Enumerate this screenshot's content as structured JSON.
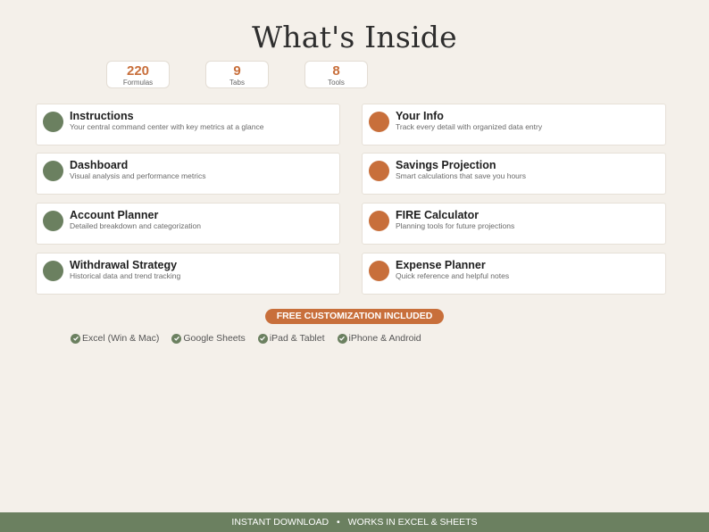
{
  "title": "What's Inside",
  "stats": [
    {
      "value": "220",
      "label": "Formulas"
    },
    {
      "value": "9",
      "label": "Tabs"
    },
    {
      "value": "8",
      "label": "Tools"
    }
  ],
  "cards": [
    {
      "title": "Instructions",
      "desc": "Your central command center with key metrics at a glance",
      "color": "#6b8060"
    },
    {
      "title": "Your Info",
      "desc": "Track every detail with organized data entry",
      "color": "#c86f3b"
    },
    {
      "title": "Dashboard",
      "desc": "Visual analysis and performance metrics",
      "color": "#6b8060"
    },
    {
      "title": "Savings Projection",
      "desc": "Smart calculations that save you hours",
      "color": "#c86f3b"
    },
    {
      "title": "Account Planner",
      "desc": "Detailed breakdown and categorization",
      "color": "#6b8060"
    },
    {
      "title": "FIRE Calculator",
      "desc": "Planning tools for future projections",
      "color": "#c86f3b"
    },
    {
      "title": "Withdrawal Strategy",
      "desc": "Historical data and trend tracking",
      "color": "#6b8060"
    },
    {
      "title": "Expense Planner",
      "desc": "Quick reference and helpful notes",
      "color": "#c86f3b"
    }
  ],
  "badge": "FREE CUSTOMIZATION INCLUDED",
  "compat": [
    {
      "label": "Excel (Win & Mac)",
      "icon": "check-icon"
    },
    {
      "label": "Google Sheets",
      "icon": "check-icon"
    },
    {
      "label": "iPad & Tablet",
      "icon": "check-icon"
    },
    {
      "label": "iPhone & Android",
      "icon": "check-icon"
    }
  ],
  "footer": {
    "left": "INSTANT DOWNLOAD",
    "separator": "•",
    "right": "WORKS IN EXCEL & SHEETS"
  },
  "colors": {
    "background": "#f4f0ea",
    "green": "#6b8060",
    "orange": "#c86f3b"
  }
}
